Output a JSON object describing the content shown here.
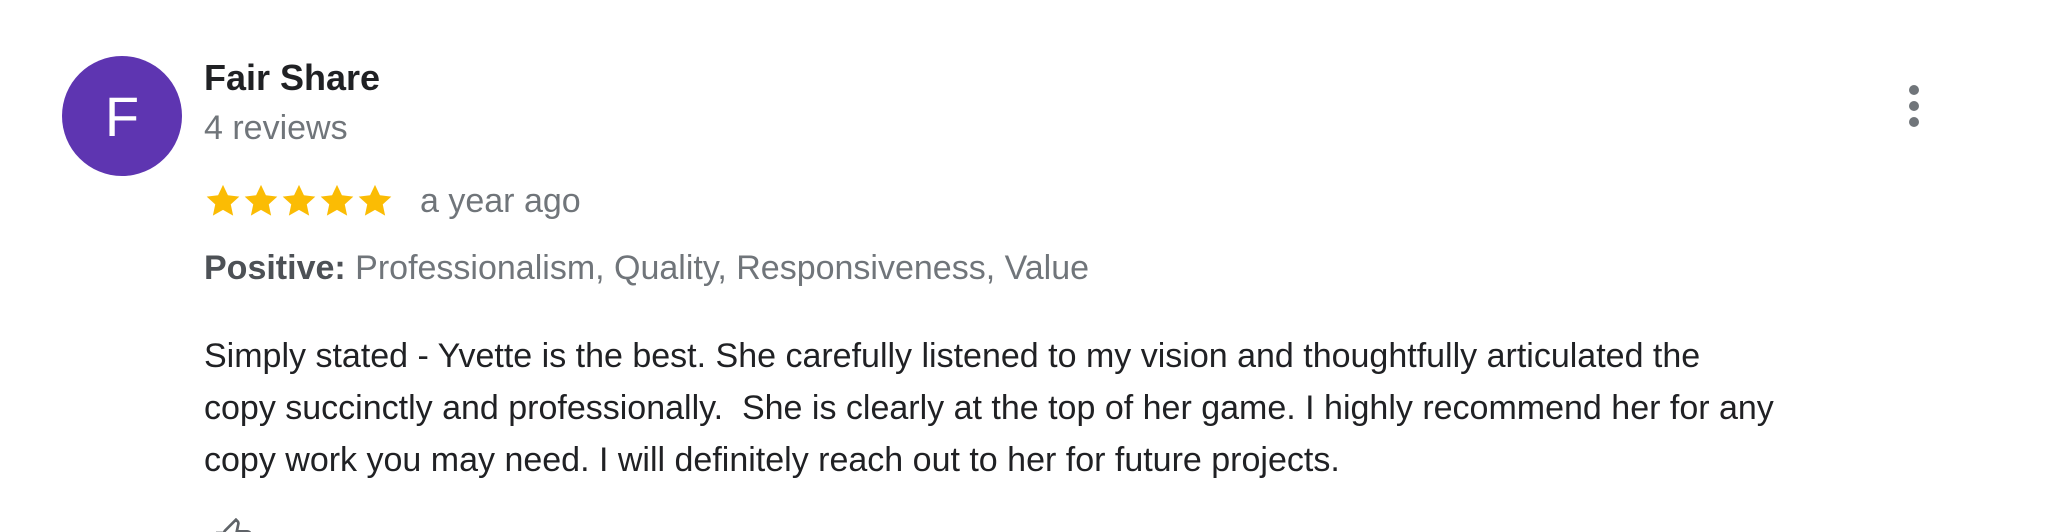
{
  "review": {
    "author": {
      "initial": "F",
      "name": "Fair Share",
      "review_count": "4 reviews",
      "avatar_color": "#5e35b1"
    },
    "rating": 5,
    "star_color": "#fbbc04",
    "time": "a year ago",
    "attributes": {
      "label": "Positive:",
      "values": "Professionalism, Quality, Responsiveness, Value"
    },
    "text_lines": [
      "Simply stated - Yvette is the best. She carefully listened to my vision and thoughtfully articulated the",
      "copy succinctly and professionally.  She is clearly at the top of her game. I highly recommend her for any",
      "copy work you may need. I will definitely reach out to her for future projects."
    ],
    "icons": {
      "more": "more-vert-icon",
      "star": "star-icon",
      "like": "thumb-up-icon"
    }
  }
}
